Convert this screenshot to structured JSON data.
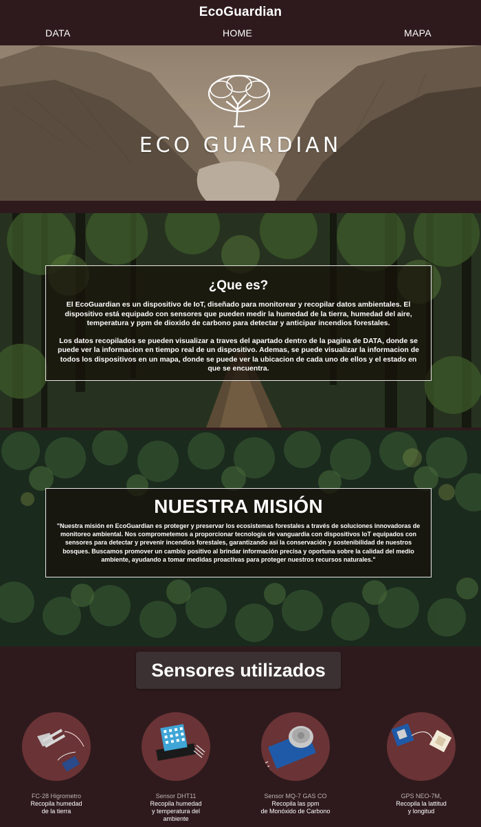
{
  "header": {
    "title": "EcoGuardian",
    "nav": {
      "data": "DATA",
      "home": "HOME",
      "mapa": "MAPA"
    }
  },
  "hero": {
    "brand": "ECO GUARDIAN"
  },
  "que_es": {
    "title": "¿Que es?",
    "paragraph_1": "El EcoGuardian es un dispositivo de IoT, diseñado para monitorear y recopilar datos ambientales. El dispositivo está equipado con sensores que pueden medir la humedad de la tierra, humedad del aire, temperatura y ppm de dioxido de carbono para detectar y anticipar incendios forestales.",
    "paragraph_2": "Los datos recopilados se pueden visualizar a traves del apartado dentro de la pagina de DATA, donde se puede ver la informacion en tiempo real de un dispositivo. Ademas, se puede visualizar la informacion de todos los dispositivos en un mapa, donde se puede ver la ubicacion de cada uno de ellos y el estado en que se encuentra."
  },
  "mision": {
    "title": "NUESTRA MISIÓN",
    "text": "\"Nuestra misión en EcoGuardian es proteger y preservar los ecosistemas forestales a través de soluciones innovadoras de monitoreo ambiental. Nos comprometemos a proporcionar tecnología de vanguardia con dispositivos IoT equipados con sensores para detectar y prevenir incendios forestales, garantizando así la conservación y sostenibilidad de nuestros bosques. Buscamos promover un cambio positivo al brindar información precisa y oportuna sobre la calidad del medio ambiente, ayudando a tomar medidas proactivas para proteger nuestros recursos naturales.\""
  },
  "sensors": {
    "heading": "Sensores utilizados",
    "items": [
      {
        "name": "FC-28 Higrometro",
        "desc_1": "Recopila humedad",
        "desc_2": "de la tierra",
        "desc_3": ""
      },
      {
        "name": "Sensor DHT11",
        "desc_1": "Recopila humedad",
        "desc_2": "y temperatura del",
        "desc_3": "ambiente"
      },
      {
        "name": "Sensor MQ-7 GAS CO",
        "desc_1": "Recopila las ppm",
        "desc_2": "de Monóxido de Carbono",
        "desc_3": ""
      },
      {
        "name": "GPS NEO-7M,",
        "desc_1": "Recopila la lattitud",
        "desc_2": "y longitud",
        "desc_3": ""
      }
    ]
  },
  "colors": {
    "page_bg": "#2e1a1d",
    "sensor_circle": "#6a3335",
    "heading_box": "#3b3133",
    "sensor_name": "#bfb3b3"
  }
}
